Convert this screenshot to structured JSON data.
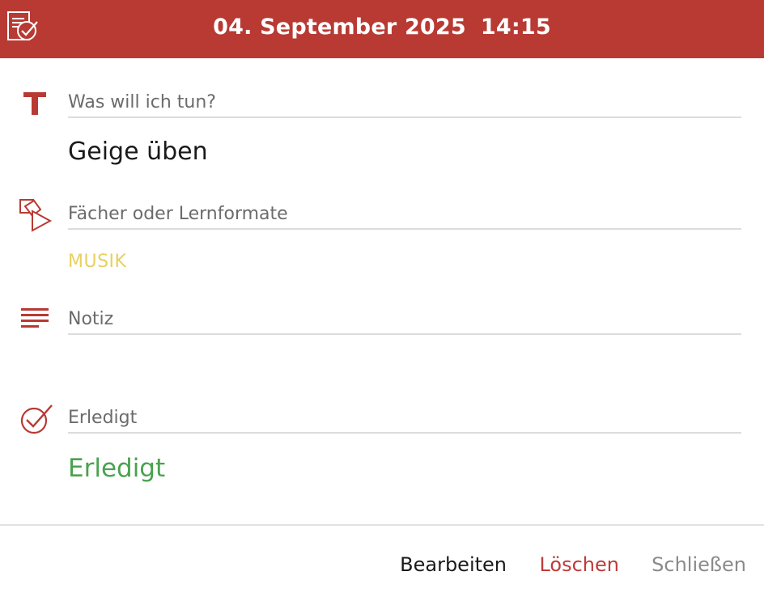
{
  "header": {
    "date": "04. September 2025",
    "time": "14:15",
    "icon": "task-checklist-icon"
  },
  "fields": {
    "title": {
      "label": "Was will ich tun?",
      "value": "Geige üben",
      "icon": "text-t-icon"
    },
    "subject": {
      "label": "Fächer oder Lernformate",
      "value": "MUSIK",
      "value_color": "#e8d060",
      "icon": "subjects-shapes-icon"
    },
    "note": {
      "label": "Notiz",
      "value": "",
      "icon": "lines-note-icon"
    },
    "done": {
      "label": "Erledigt",
      "value": "Erledigt",
      "value_color": "#4aa24f",
      "icon": "check-circle-icon"
    }
  },
  "footer": {
    "edit_label": "Bearbeiten",
    "delete_label": "Löschen",
    "close_label": "Schließen"
  },
  "colors": {
    "brand": "#b83a33",
    "delete": "#c0393a",
    "done": "#4aa24f",
    "subject": "#e8d060"
  }
}
